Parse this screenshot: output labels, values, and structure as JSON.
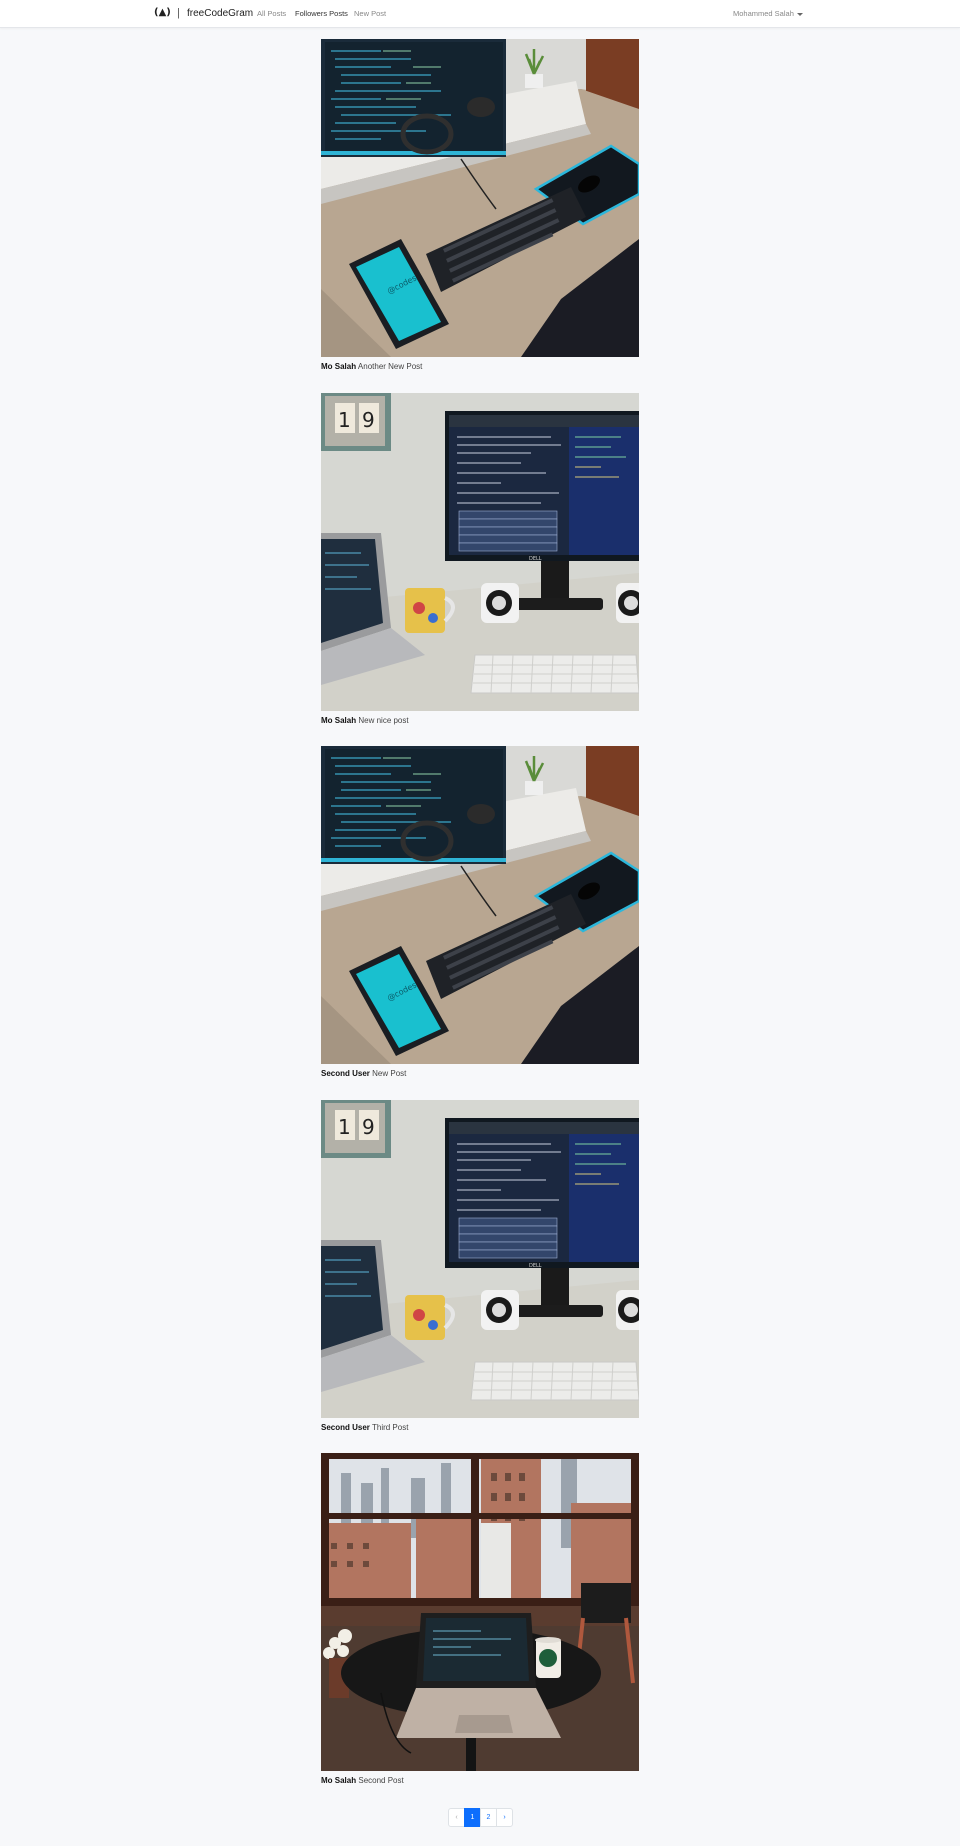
{
  "navbar": {
    "logo_glyph": "(▲)",
    "separator": "|",
    "brand": "freeCodeGram",
    "links": [
      "All Posts",
      "Followers Posts",
      "New Post"
    ],
    "user": "Mohammed Salah"
  },
  "posts": [
    {
      "author": "Mo Salah",
      "caption": "Another New Post",
      "image": "desk-setup-monitor-tablet-photo"
    },
    {
      "author": "Mo Salah",
      "caption": "New nice post",
      "image": "desk-setup-dell-monitor-laptop-photo"
    },
    {
      "author": "Second User",
      "caption": "New Post",
      "image": "desk-setup-monitor-tablet-photo"
    },
    {
      "author": "Second User",
      "caption": "Third Post",
      "image": "desk-setup-dell-monitor-laptop-photo"
    },
    {
      "author": "Mo Salah",
      "caption": "Second Post",
      "image": "city-window-laptop-table-photo"
    }
  ],
  "pagination": {
    "prev": "‹",
    "pages": [
      "1",
      "2"
    ],
    "next": "›",
    "current": 1
  },
  "colors": {
    "accent": "#0d6efd",
    "page_background": "#f7f8fa"
  }
}
